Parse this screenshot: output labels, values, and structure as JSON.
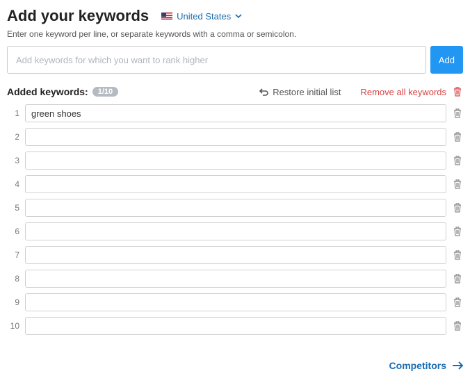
{
  "header": {
    "title": "Add your keywords",
    "country": "United States"
  },
  "instruction": "Enter one keyword per line, or separate keywords with a comma or semicolon.",
  "addInput": {
    "placeholder": "Add keywords for which you want to rank higher",
    "buttonLabel": "Add"
  },
  "toolbar": {
    "addedLabel": "Added keywords:",
    "count": "1/10",
    "restoreLabel": "Restore initial list",
    "removeAllLabel": "Remove all keywords"
  },
  "keywords": [
    {
      "n": "1",
      "value": "green shoes"
    },
    {
      "n": "2",
      "value": ""
    },
    {
      "n": "3",
      "value": ""
    },
    {
      "n": "4",
      "value": ""
    },
    {
      "n": "5",
      "value": ""
    },
    {
      "n": "6",
      "value": ""
    },
    {
      "n": "7",
      "value": ""
    },
    {
      "n": "8",
      "value": ""
    },
    {
      "n": "9",
      "value": ""
    },
    {
      "n": "10",
      "value": ""
    }
  ],
  "footer": {
    "competitorsLabel": "Competitors"
  }
}
